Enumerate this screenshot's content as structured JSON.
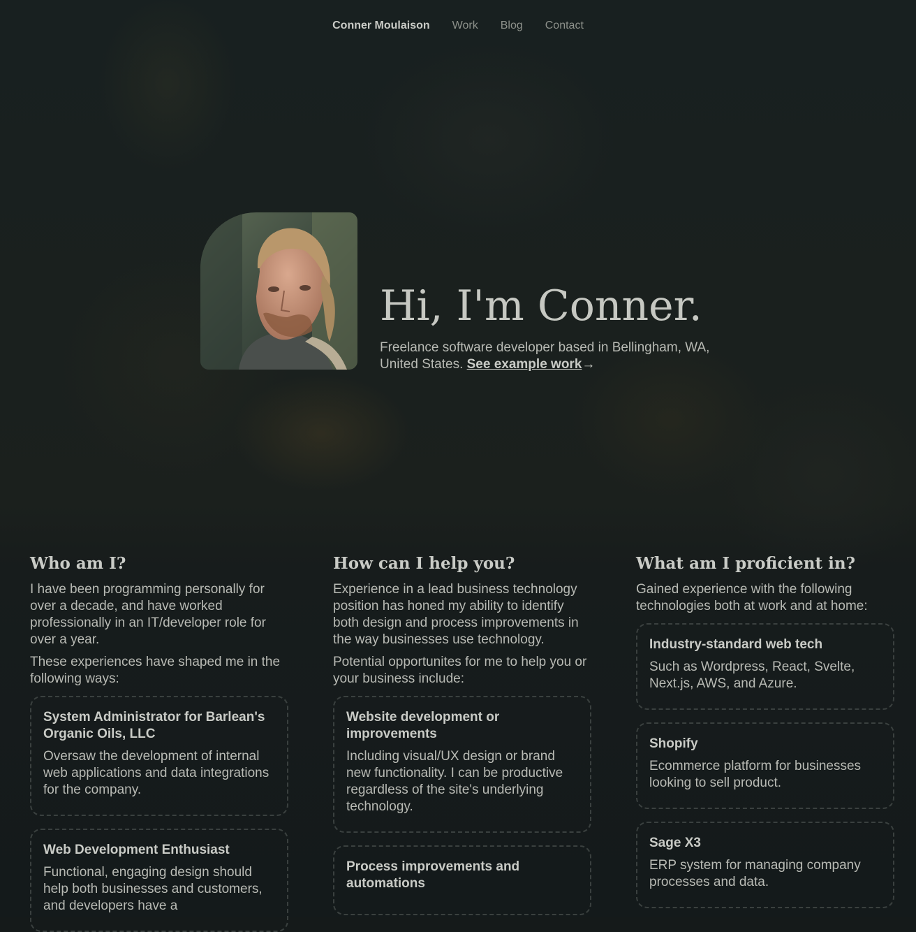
{
  "nav": {
    "brand": "Conner Moulaison",
    "links": [
      "Work",
      "Blog",
      "Contact"
    ]
  },
  "hero": {
    "title": "Hi, I'm Conner.",
    "subtitle": "Freelance software developer based in Bellingham, WA, United States.",
    "cta": "See example work",
    "cta_arrow": "→"
  },
  "columns": [
    {
      "heading": "Who am I?",
      "paragraphs": [
        "I have been programming personally for over a decade, and have worked professionally in an IT/developer role for over a year.",
        "These experiences have shaped me in the following ways:"
      ],
      "cards": [
        {
          "title": "System Administrator for Barlean's Organic Oils, LLC",
          "desc": "Oversaw the development of internal web applications and data integrations for the company."
        },
        {
          "title": "Web Development Enthusiast",
          "desc": "Functional, engaging design should help both businesses and customers, and developers have a"
        }
      ]
    },
    {
      "heading": "How can I help you?",
      "paragraphs": [
        "Experience in a lead business technology position has honed my ability to identify both design and process improvements in the way businesses use technology.",
        "Potential opportunites for me to help you or your business include:"
      ],
      "cards": [
        {
          "title": "Website development or improvements",
          "desc": "Including visual/UX design or brand new functionality. I can be productive regardless of the site's underlying technology."
        },
        {
          "title": "Process improvements and automations",
          "desc": ""
        }
      ]
    },
    {
      "heading": "What am I proficient in?",
      "paragraphs": [
        "Gained experience with the following technologies both at work and at home:"
      ],
      "cards": [
        {
          "title": "Industry-standard web tech",
          "desc": "Such as Wordpress, React, Svelte, Next.js, AWS, and Azure."
        },
        {
          "title": "Shopify",
          "desc": "Ecommerce platform for businesses looking to sell product."
        },
        {
          "title": "Sage X3",
          "desc": "ERP system for managing company processes and data."
        }
      ]
    }
  ]
}
